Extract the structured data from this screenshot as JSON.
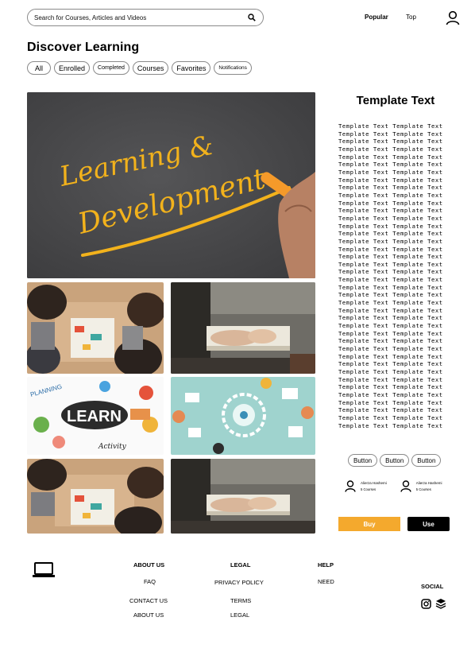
{
  "header": {
    "search_placeholder": "Search for Courses, Articles and Videos",
    "nav": [
      "Popular",
      "Top"
    ]
  },
  "page": {
    "title": "Discover Learning",
    "filters": [
      "All",
      "Enrolled",
      "Completed",
      "Courses",
      "Favorites",
      "Notifications"
    ]
  },
  "hero": {
    "line1": "Learning &",
    "line2": "Development"
  },
  "collage": {
    "learn_word": "LEARN",
    "planning_word": "PLANNING",
    "activity_word": "Activity"
  },
  "sidebar": {
    "title": "Template Text",
    "body_line": "Template Text Template Text",
    "body_line_count": 40,
    "buttons": [
      "Button",
      "Button",
      "Button"
    ],
    "authors": [
      {
        "name": "Alierza Hashemi",
        "courses": "5 Courses"
      },
      {
        "name": "Alierza Hashemi",
        "courses": "5 Courses"
      }
    ],
    "buy_label": "Buy",
    "use_label": "Use"
  },
  "footer": {
    "columns": [
      {
        "heading": "ABOUT US",
        "items": [
          "FAQ",
          "CONTACT US",
          "ABOUT US"
        ]
      },
      {
        "heading": "LEGAL",
        "items": [
          "PRIVACY POLICY",
          "TERMS",
          "LEGAL"
        ]
      },
      {
        "heading": "HELP",
        "items": [
          "NEED"
        ]
      }
    ],
    "social_label": "SOCIAL"
  },
  "colors": {
    "accent": "#f4a92d",
    "dark": "#000000",
    "hero_bg": "#4a4a4c",
    "chalk_yellow": "#f2b21c"
  },
  "icons": [
    "search-icon",
    "user-icon",
    "author-icon",
    "laptop-icon",
    "instagram-icon",
    "layers-icon"
  ]
}
